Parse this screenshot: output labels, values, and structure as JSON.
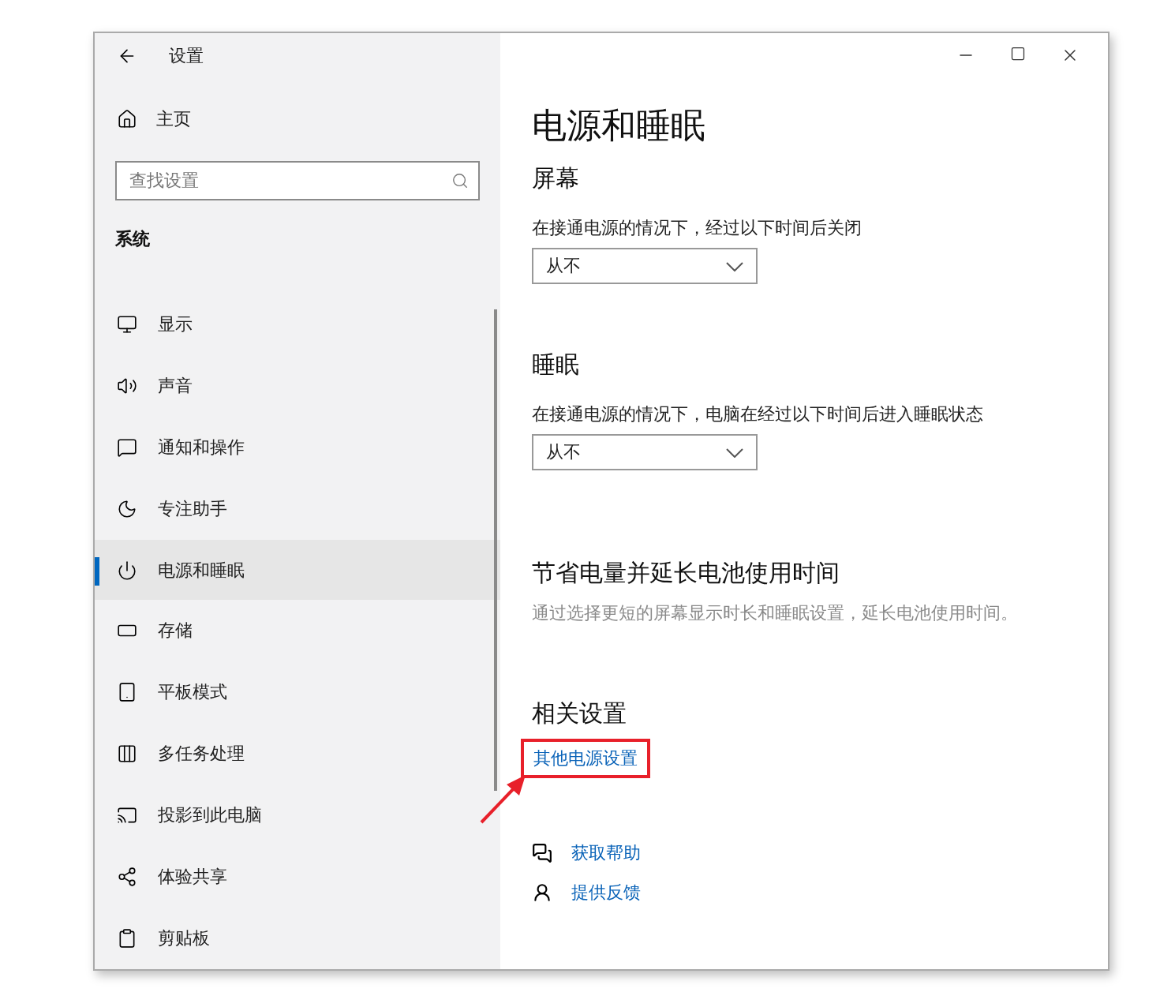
{
  "window": {
    "title": "设置"
  },
  "sidebar": {
    "home": "主页",
    "search": {
      "placeholder": "查找设置"
    },
    "group": "系统",
    "items": [
      {
        "label": "显示",
        "selected": false
      },
      {
        "label": "声音",
        "selected": false
      },
      {
        "label": "通知和操作",
        "selected": false
      },
      {
        "label": "专注助手",
        "selected": false
      },
      {
        "label": "电源和睡眠",
        "selected": true
      },
      {
        "label": "存储",
        "selected": false
      },
      {
        "label": "平板模式",
        "selected": false
      },
      {
        "label": "多任务处理",
        "selected": false
      },
      {
        "label": "投影到此电脑",
        "selected": false
      },
      {
        "label": "体验共享",
        "selected": false
      },
      {
        "label": "剪贴板",
        "selected": false
      }
    ]
  },
  "content": {
    "title": "电源和睡眠",
    "sections": [
      {
        "heading": "屏幕",
        "description": "在接通电源的情况下，经过以下时间后关闭",
        "dropdown": {
          "value": "从不"
        }
      },
      {
        "heading": "睡眠",
        "description": "在接通电源的情况下，电脑在经过以下时间后进入睡眠状态",
        "dropdown": {
          "value": "从不"
        }
      }
    ],
    "battery": {
      "heading": "节省电量并延长电池使用时间",
      "description": "通过选择更短的屏幕显示时长和睡眠设置，延长电池使用时间。"
    },
    "related": {
      "heading": "相关设置",
      "links": [
        {
          "label": "其他电源设置",
          "highlighted": true
        }
      ]
    },
    "support": [
      {
        "label": "获取帮助"
      },
      {
        "label": "提供反馈"
      }
    ]
  }
}
